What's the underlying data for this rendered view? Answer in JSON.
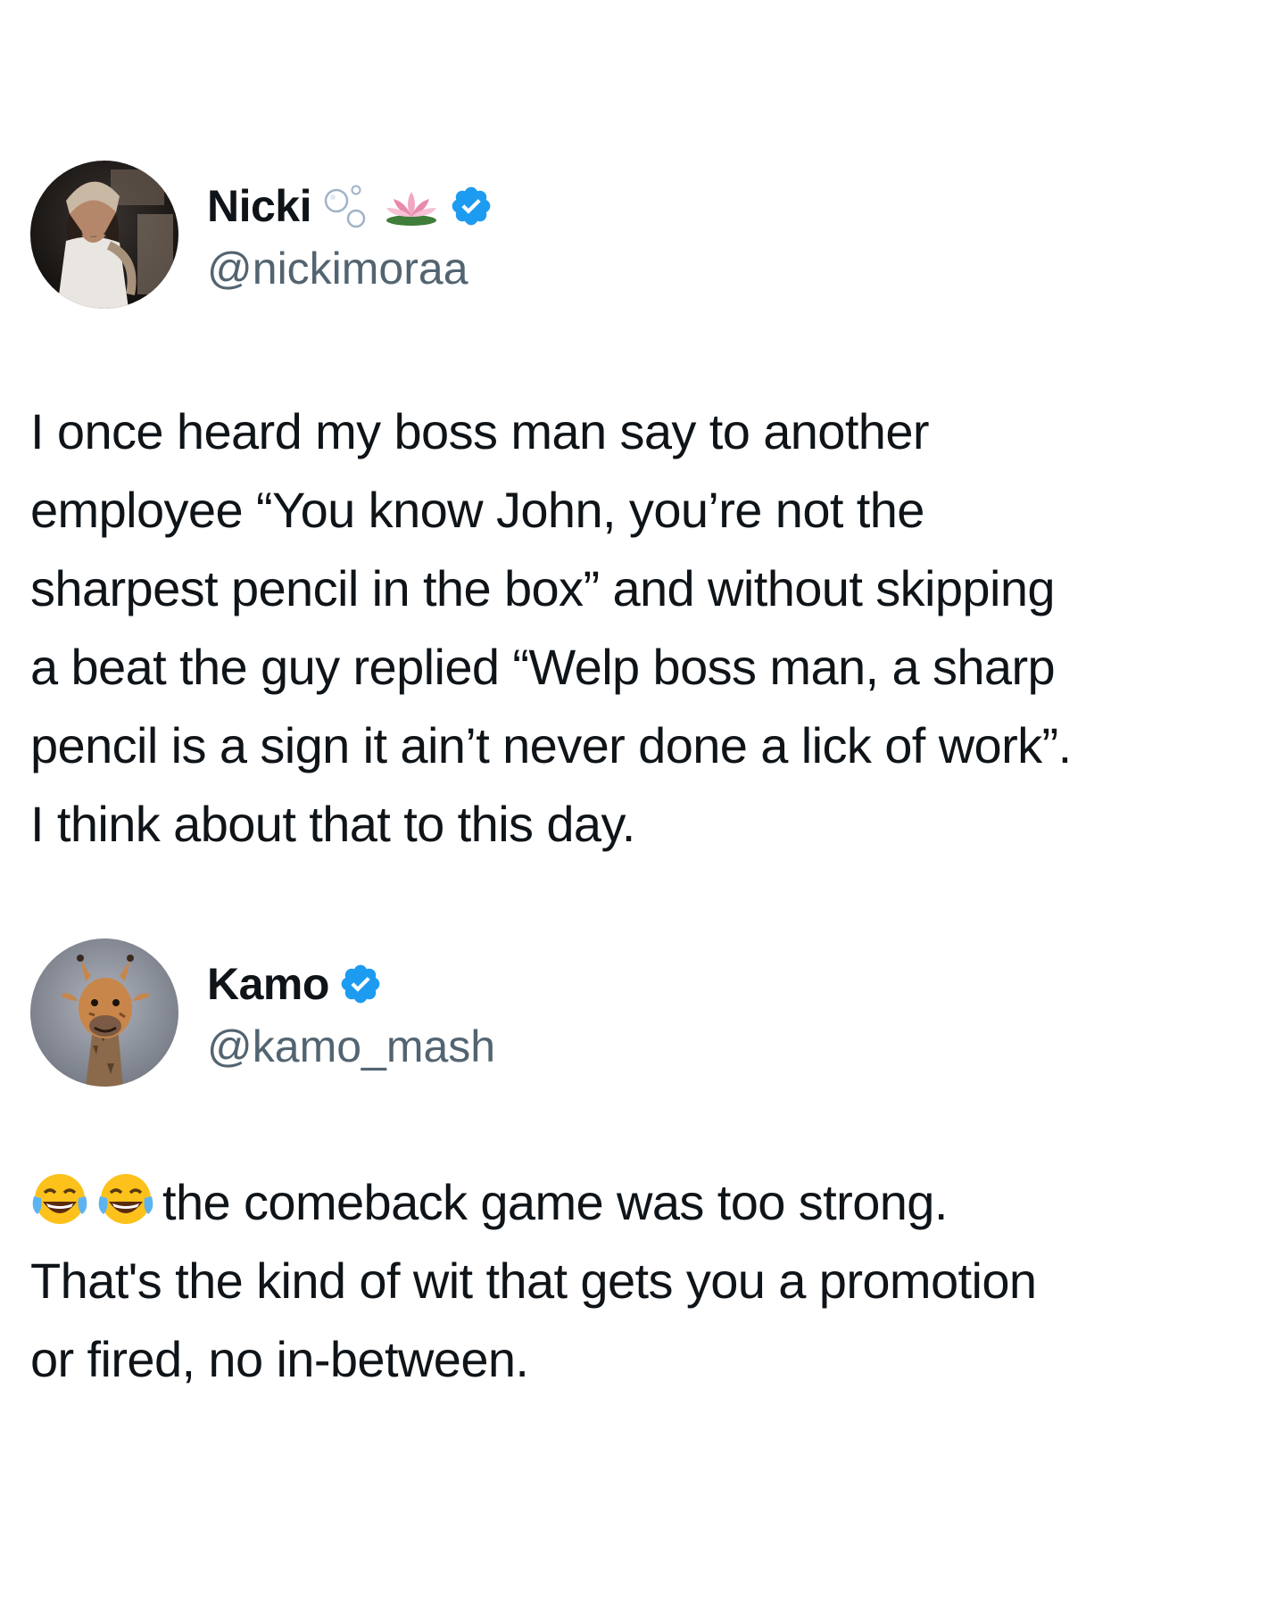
{
  "posts": [
    {
      "author": {
        "display_name": "Nicki",
        "handle": "@nickimoraa",
        "name_decorations": [
          "bubbles-icon",
          "lotus-icon"
        ],
        "verified": true
      },
      "text_lines": [
        "I once heard my boss man say to another",
        "employee “You know John, you’re not the",
        "sharpest pencil in the box” and without skipping",
        "a beat the guy replied “Welp boss man, a sharp",
        "pencil is a sign it ain’t never done a lick of work”.",
        "I think about that to this day."
      ]
    },
    {
      "author": {
        "display_name": "Kamo",
        "handle": "@kamo_mash",
        "verified": true
      },
      "leading_emoji": [
        "face-with-tears-of-joy-icon",
        "face-with-tears-of-joy-icon"
      ],
      "text_lines": [
        "the comeback game was too strong.",
        "That's the kind of wit that gets you a promotion",
        "or fired, no in-between."
      ]
    }
  ],
  "colors": {
    "text_primary": "#0f1419",
    "text_secondary": "#536471",
    "verified_blue": "#1d9bf0",
    "background": "#ffffff"
  }
}
